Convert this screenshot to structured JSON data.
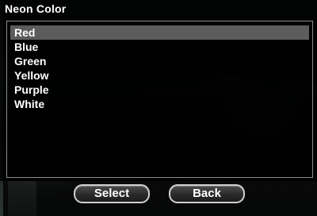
{
  "window": {
    "title": "Neon Color"
  },
  "list": {
    "items": [
      "Red",
      "Blue",
      "Green",
      "Yellow",
      "Purple",
      "White"
    ],
    "selected": "Red"
  },
  "buttons": {
    "select_label": "Select",
    "back_label": "Back"
  }
}
